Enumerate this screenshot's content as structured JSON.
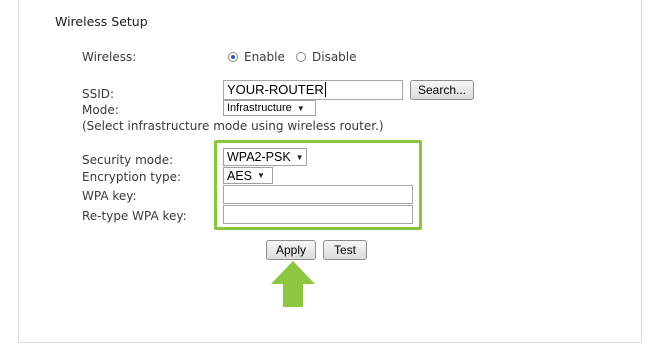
{
  "section_title": "Wireless Setup",
  "wireless": {
    "label": "Wireless:",
    "options": [
      {
        "label": "Enable",
        "selected": true
      },
      {
        "label": "Disable",
        "selected": false
      }
    ]
  },
  "ssid": {
    "label": "SSID:",
    "value": "YOUR-ROUTER",
    "search_button": "Search..."
  },
  "mode": {
    "label": "Mode:",
    "selected": "Infrastructure",
    "hint": "(Select infrastructure mode using wireless router.)"
  },
  "security": {
    "mode_label": "Security mode:",
    "mode_value": "WPA2-PSK",
    "encryption_label": "Encryption type:",
    "encryption_value": "AES",
    "wpa_key_label": "WPA key:",
    "wpa_key_value": "",
    "retype_label": "Re-type WPA key:",
    "retype_value": ""
  },
  "buttons": {
    "apply": "Apply",
    "test": "Test"
  },
  "colors": {
    "highlight": "#8bc53f",
    "arrow": "#8dc63f"
  },
  "icons": {
    "arrow": "up-arrow-icon",
    "dropdown": "chevron-down-icon"
  }
}
